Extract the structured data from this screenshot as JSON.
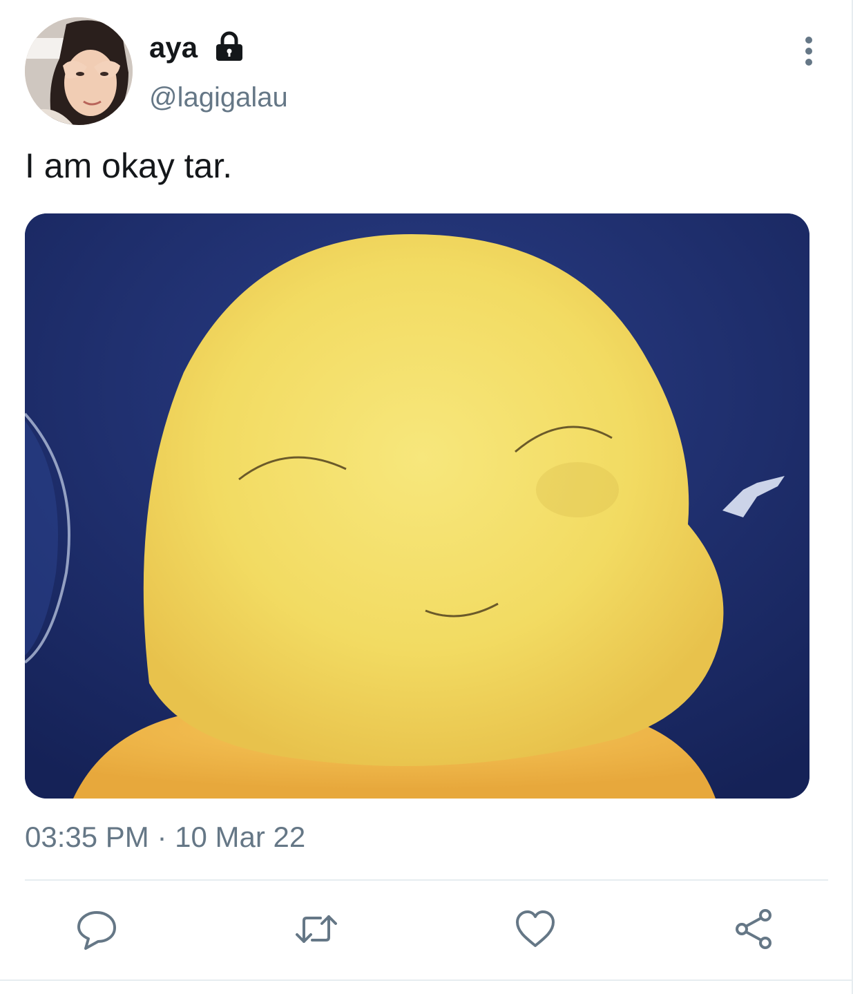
{
  "tweet": {
    "author": {
      "name": "aya",
      "handle": "@lagigalau",
      "avatar_icon": "profile-photo",
      "protected_icon": "lock-icon"
    },
    "text": "I am okay tar.",
    "media": {
      "kind": "photo"
    },
    "timestamp": "03:35 PM · 10 Mar 22"
  },
  "actions": [
    {
      "name": "reply",
      "icon": "speech-bubble-icon"
    },
    {
      "name": "retweet",
      "icon": "retweet-arrows-icon"
    },
    {
      "name": "like",
      "icon": "heart-icon"
    },
    {
      "name": "share",
      "icon": "share-icon"
    }
  ],
  "colors": {
    "text_primary": "#14171a",
    "text_secondary": "#657786",
    "divider": "#e6ecf0",
    "icon": "#657786",
    "media_background": "#1f2f6b",
    "character_yellow": "#f2dc63"
  }
}
